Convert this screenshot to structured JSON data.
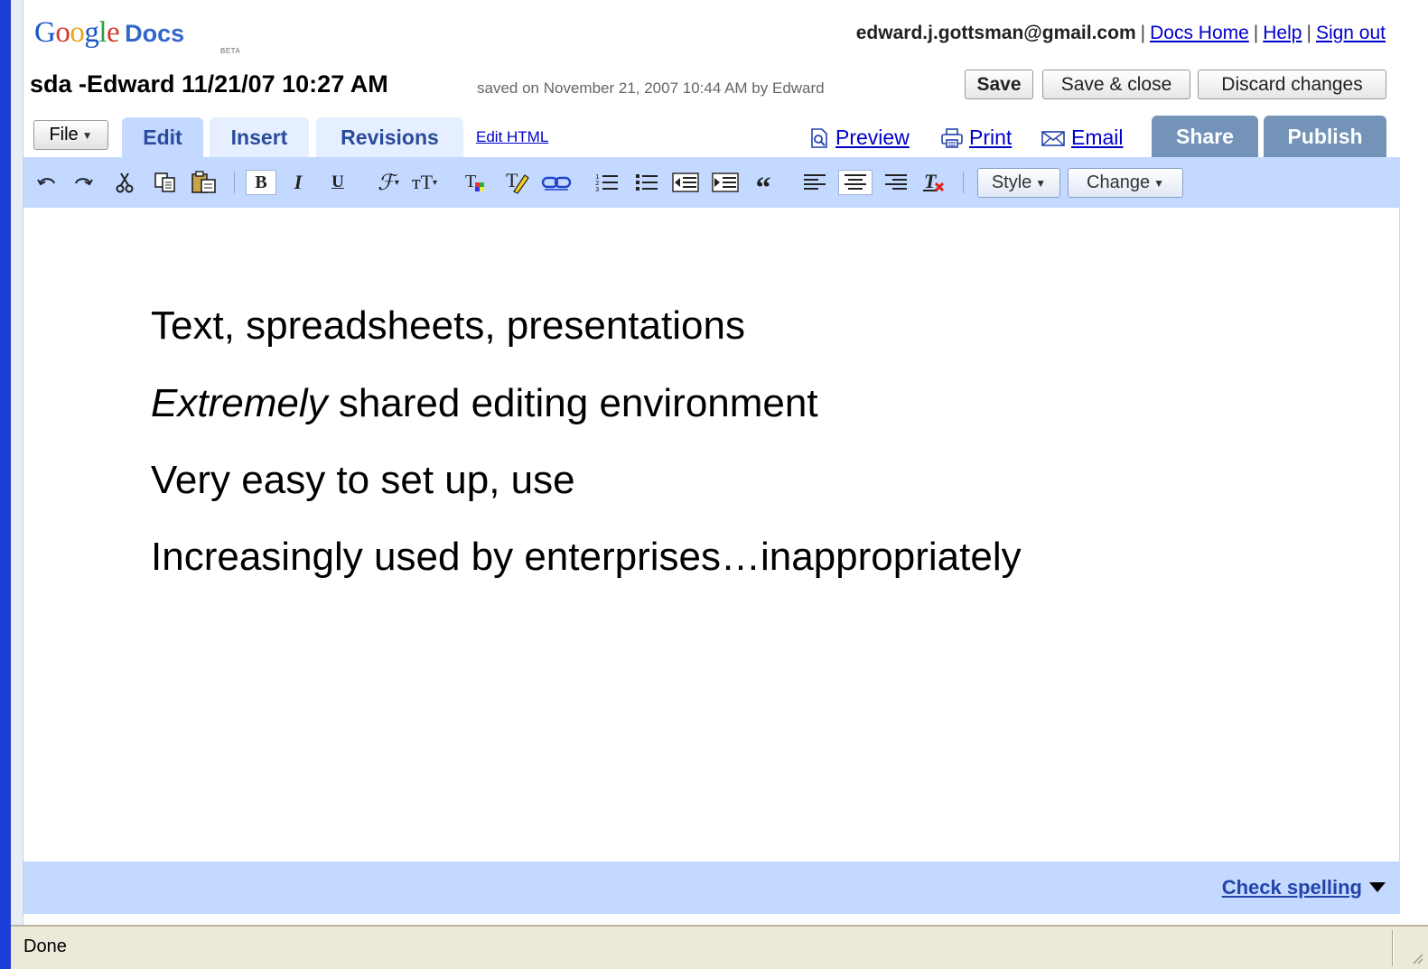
{
  "header": {
    "logo_google": "Google",
    "logo_docs": "Docs",
    "logo_beta": "BETA",
    "user_email": "edward.j.gottsman@gmail.com",
    "links": [
      "Docs Home",
      "Help",
      "Sign out"
    ],
    "separator": "|"
  },
  "document": {
    "title": "sda -Edward 11/21/07 10:27 AM",
    "saved_info": "saved on November 21, 2007 10:44 AM by Edward"
  },
  "buttons": {
    "save": "Save",
    "save_close": "Save & close",
    "discard": "Discard changes"
  },
  "tabs": {
    "file": "File",
    "edit": "Edit",
    "insert": "Insert",
    "revisions": "Revisions",
    "edit_html": "Edit HTML",
    "preview": "Preview",
    "print": "Print",
    "email": "Email",
    "share": "Share",
    "publish": "Publish"
  },
  "toolbar": {
    "style_label": "Style",
    "change_label": "Change",
    "icons": [
      "undo-icon",
      "redo-icon",
      "cut-icon",
      "copy-icon",
      "paste-icon",
      "bold-icon",
      "italic-icon",
      "underline-icon",
      "font-icon",
      "font-size-icon",
      "text-color-icon",
      "highlight-icon",
      "link-icon",
      "numbered-list-icon",
      "bullet-list-icon",
      "outdent-icon",
      "indent-icon",
      "blockquote-icon",
      "align-left-icon",
      "align-center-icon",
      "align-right-icon",
      "remove-formatting-icon"
    ]
  },
  "content": {
    "line1": "Text, spreadsheets, presentations",
    "line2_emph": "Extremely",
    "line2_rest": " shared editing environment",
    "line3": "Very easy to set up, use",
    "line4": "Increasingly used by enterprises…inappropriately"
  },
  "footer": {
    "check_spelling": "Check spelling"
  },
  "status_bar": {
    "text": "Done"
  },
  "colors": {
    "accent_blue": "#c3d9ff",
    "tab_inactive": "#e5efff",
    "share_tab": "#7393b9",
    "link": "#0000cc",
    "window_border": "#1b3fd6"
  }
}
